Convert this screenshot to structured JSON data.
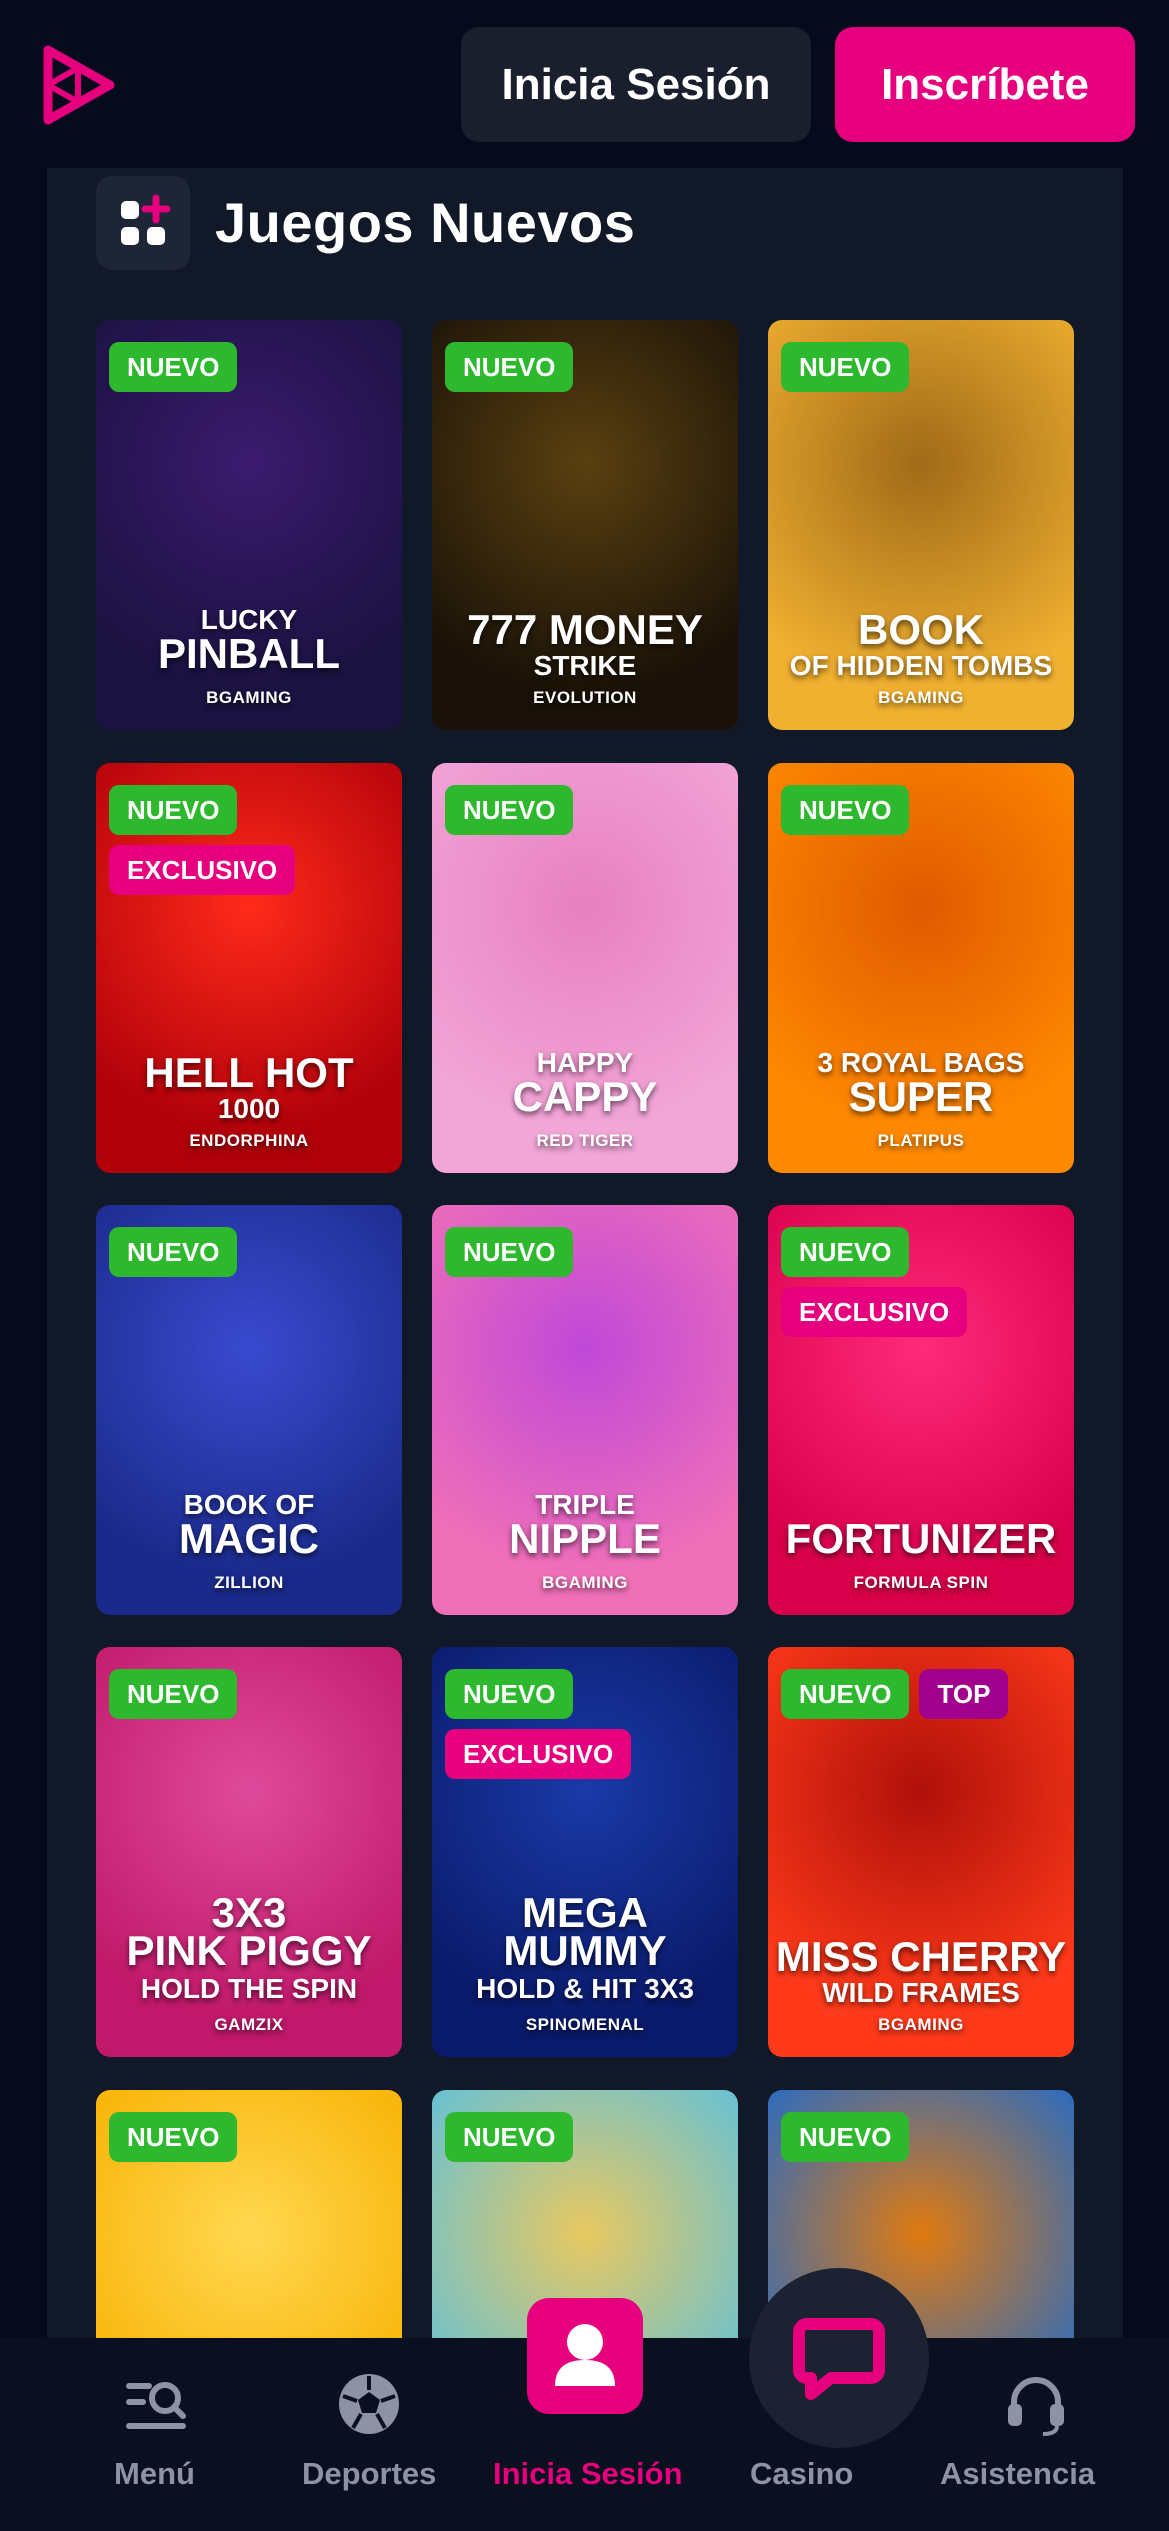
{
  "header": {
    "logo_icon": "play-logo-icon",
    "login_label": "Inicia Sesión",
    "signup_label": "Inscríbete",
    "accent_color": "#e6007e"
  },
  "section": {
    "icon": "games-grid-icon",
    "title": "Juegos Nuevos"
  },
  "games": [
    {
      "badges": [
        "NUEVO"
      ],
      "line1": "LUCKY",
      "line2": "PINBALL",
      "line3": "",
      "provider": "BGAMING"
    },
    {
      "badges": [
        "NUEVO"
      ],
      "line1": "",
      "line2": "777 MONEY",
      "line3": "STRIKE",
      "provider": "EVOLUTION"
    },
    {
      "badges": [
        "NUEVO"
      ],
      "line1": "",
      "line2": "BOOK",
      "line3": "OF HIDDEN TOMBS",
      "provider": "BGAMING"
    },
    {
      "badges": [
        "NUEVO",
        "EXCLUSIVO"
      ],
      "line1": "",
      "line2": "HELL HOT",
      "line3": "1000",
      "provider": "ENDORPHINA"
    },
    {
      "badges": [
        "NUEVO"
      ],
      "line1": "HAPPY",
      "line2": "CAPPY",
      "line3": "",
      "provider": "RED TIGER"
    },
    {
      "badges": [
        "NUEVO"
      ],
      "line1": "3 ROYAL BAGS",
      "line2": "SUPER",
      "line3": "",
      "provider": "PLATIPUS"
    },
    {
      "badges": [
        "NUEVO"
      ],
      "line1": "BOOK OF",
      "line2": "MAGIC",
      "line3": "",
      "provider": "ZILLION"
    },
    {
      "badges": [
        "NUEVO"
      ],
      "line1": "TRIPLE",
      "line2": "NIPPLE",
      "line3": "",
      "provider": "BGAMING"
    },
    {
      "badges": [
        "NUEVO",
        "EXCLUSIVO"
      ],
      "line1": "",
      "line2": "FORTUNIZER",
      "line3": "",
      "provider": "FORMULA SPIN"
    },
    {
      "badges": [
        "NUEVO"
      ],
      "line1": "3X3",
      "line2": "PINK PIGGY",
      "line3": "HOLD THE SPIN",
      "provider": "GAMZIX"
    },
    {
      "badges": [
        "NUEVO",
        "EXCLUSIVO"
      ],
      "line1": "MEGA",
      "line2": "MUMMY",
      "line3": "HOLD & HIT 3X3",
      "provider": "SPINOMENAL"
    },
    {
      "badges": [
        "NUEVO",
        "TOP"
      ],
      "line1": "",
      "line2": "MISS CHERRY",
      "line3": "WILD FRAMES",
      "provider": "BGAMING"
    },
    {
      "badges": [
        "NUEVO"
      ],
      "line1": "",
      "line2": "",
      "line3": "",
      "provider": ""
    },
    {
      "badges": [
        "NUEVO"
      ],
      "line1": "",
      "line2": "",
      "line3": "",
      "provider": ""
    },
    {
      "badges": [
        "NUEVO"
      ],
      "line1": "",
      "line2": "",
      "line3": "",
      "provider": ""
    }
  ],
  "card_colors": [
    [
      "#1a1240",
      "#3b1a6e"
    ],
    [
      "#1a1208",
      "#5a4010"
    ],
    [
      "#f0b030",
      "#a06a18"
    ],
    [
      "#b0000a",
      "#ff2a1a"
    ],
    [
      "#f2a6d8",
      "#e880c0"
    ],
    [
      "#ff8a00",
      "#e05a00"
    ],
    [
      "#1a2a8a",
      "#3a4ad0"
    ],
    [
      "#f070b8",
      "#c048d8"
    ],
    [
      "#d8004a",
      "#ff2a7a"
    ],
    [
      "#c0186a",
      "#e04a9a"
    ],
    [
      "#0a1a6a",
      "#1a3aa8"
    ],
    [
      "#ff3a1a",
      "#b0100a"
    ],
    [
      "#f8b000",
      "#ffd850"
    ],
    [
      "#5ac0e0",
      "#e8c860"
    ],
    [
      "#1a6ad0",
      "#e07a10"
    ]
  ],
  "bottom_nav": {
    "menu_label": "Menú",
    "sports_label": "Deportes",
    "login_label": "Inicia Sesión",
    "casino_label": "Casino",
    "help_label": "Asistencia",
    "menu_icon": "menu-search-icon",
    "sports_icon": "soccer-ball-icon",
    "login_icon": "user-icon",
    "casino_icon": "chat-icon",
    "help_icon": "headset-icon"
  }
}
